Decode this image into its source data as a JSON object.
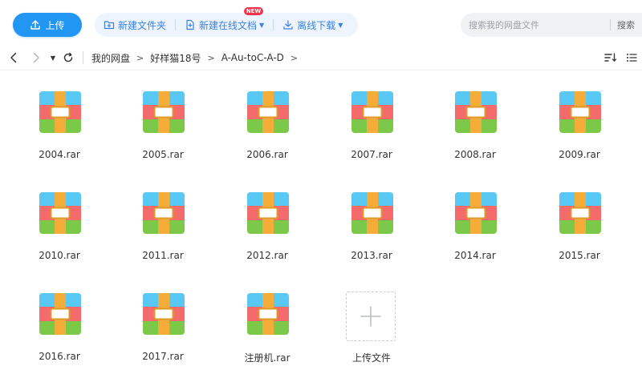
{
  "toolbar": {
    "upload_label": "上传",
    "new_folder_label": "新建文件夹",
    "new_online_doc_label": "新建在线文档",
    "new_badge": "NEW",
    "offline_download_label": "离线下载"
  },
  "search": {
    "placeholder": "搜索我的网盘文件",
    "button_label": "搜索"
  },
  "breadcrumb": [
    "我的网盘",
    "好样猫18号",
    "A-Au-toC-A-D"
  ],
  "files": [
    {
      "name": "2004.rar"
    },
    {
      "name": "2005.rar"
    },
    {
      "name": "2006.rar"
    },
    {
      "name": "2007.rar"
    },
    {
      "name": "2008.rar"
    },
    {
      "name": "2009.rar"
    },
    {
      "name": "2010.rar"
    },
    {
      "name": "2011.rar"
    },
    {
      "name": "2012.rar"
    },
    {
      "name": "2013.rar"
    },
    {
      "name": "2014.rar"
    },
    {
      "name": "2015.rar"
    },
    {
      "name": "2016.rar"
    },
    {
      "name": "2017.rar"
    },
    {
      "name": "注册机.rar"
    }
  ],
  "upload_tile_label": "上传文件",
  "colors": {
    "accent": "#2196f3",
    "archive_top": "#5ac8f5",
    "archive_middle": "#f36b6b",
    "archive_bottom": "#7cc94a",
    "archive_strap": "#f5ad3a"
  }
}
